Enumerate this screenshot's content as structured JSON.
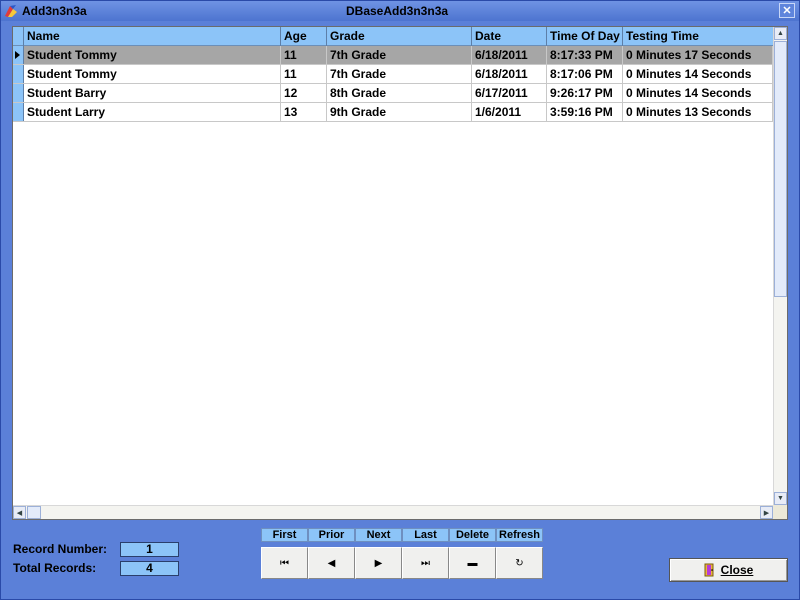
{
  "titlebar": {
    "app_title": "Add3n3n3a",
    "window_title": "DBaseAdd3n3n3a",
    "close_glyph": "✕",
    "app_icon": "app-icon"
  },
  "grid": {
    "columns": [
      "Name",
      "Age",
      "Grade",
      "Date",
      "Time Of Day",
      "Testing Time"
    ],
    "rows": [
      {
        "name": "Student Tommy",
        "age": "11",
        "grade": "7th Grade",
        "date": "6/18/2011",
        "time": "8:17:33 PM",
        "testing": "0 Minutes  17 Seconds"
      },
      {
        "name": "Student Tommy",
        "age": "11",
        "grade": "7th Grade",
        "date": "6/18/2011",
        "time": "8:17:06 PM",
        "testing": "0 Minutes  14 Seconds"
      },
      {
        "name": "Student Barry",
        "age": "12",
        "grade": "8th Grade",
        "date": "6/17/2011",
        "time": "9:26:17 PM",
        "testing": "0 Minutes  14 Seconds"
      },
      {
        "name": "Student Larry",
        "age": "13",
        "grade": "9th Grade",
        "date": "1/6/2011",
        "time": "3:59:16 PM",
        "testing": "0 Minutes  13 Seconds"
      }
    ],
    "selected_row": 0
  },
  "records": {
    "record_number_label": "Record Number:",
    "record_number": "1",
    "total_records_label": "Total Records:",
    "total_records": "4"
  },
  "navigator": {
    "labels": [
      "First",
      "Prior",
      "Next",
      "Last",
      "Delete",
      "Refresh"
    ],
    "glyphs": [
      "⏮",
      "◀",
      "▶",
      "⏭",
      "▬",
      "↻"
    ]
  },
  "close_button": {
    "label": "Close",
    "icon": "door-icon"
  },
  "colors": {
    "window_bg": "#5b80d8",
    "header_bg": "#8cc4f8",
    "selected_row_bg": "#a6a6a6"
  }
}
